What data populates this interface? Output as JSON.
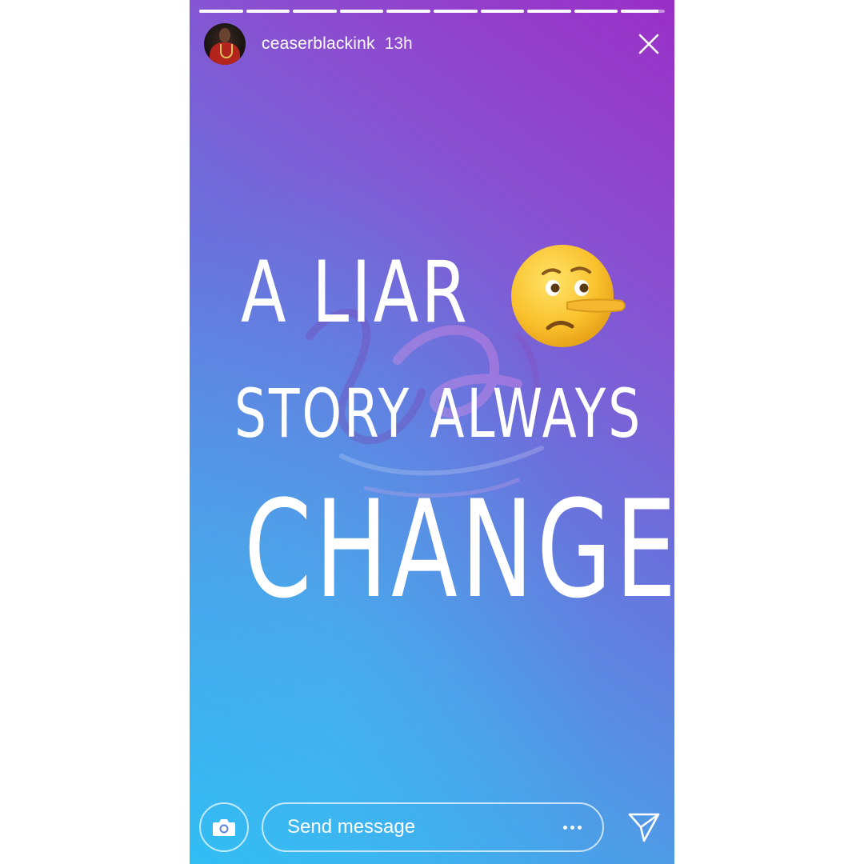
{
  "colors": {
    "gradient_start": "#2fbcf2",
    "gradient_mid": "#6a72dc",
    "gradient_end": "#9a2fc6",
    "text": "#ffffff"
  },
  "story": {
    "progress": {
      "segments": 10,
      "current_segment": 10,
      "current_fill": 0.85
    },
    "header": {
      "username": "ceaserblackink",
      "time": "13h",
      "avatar_icon": "profile-photo",
      "close_icon": "close-icon"
    },
    "content": {
      "line1": "A LIAR",
      "emoji": "lying-face-emoji",
      "line2": "STORY ALWAYS",
      "line3": "CHANGE",
      "watermark": "logo-watermark"
    },
    "footer": {
      "camera_icon": "camera-icon",
      "message_placeholder": "Send message",
      "more_icon": "more-dots-icon",
      "send_icon": "send-direct-icon"
    }
  }
}
